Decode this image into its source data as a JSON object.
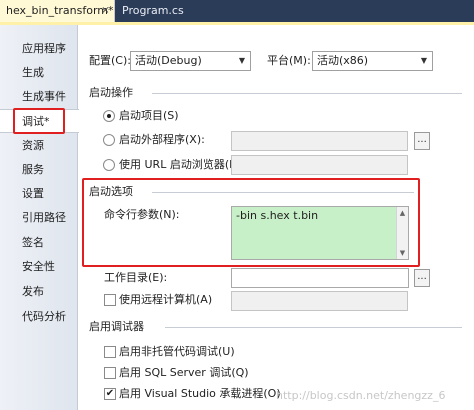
{
  "tabs": [
    {
      "label": "hex_bin_transform*",
      "close": "×"
    },
    {
      "label": "Program.cs"
    }
  ],
  "sidebar": {
    "items": [
      "应用程序",
      "生成",
      "生成事件",
      "调试*",
      "资源",
      "服务",
      "设置",
      "引用路径",
      "签名",
      "安全性",
      "发布",
      "代码分析"
    ]
  },
  "config": {
    "config_label": "配置(C):",
    "config_value": "活动(Debug)",
    "platform_label": "平台(M):",
    "platform_value": "活动(x86)"
  },
  "start_action": {
    "title": "启动操作",
    "opt1": "启动项目(S)",
    "opt2": "启动外部程序(X):",
    "opt3": "使用 URL 启动浏览器(R):",
    "browse": "..."
  },
  "start_options": {
    "title": "启动选项",
    "args_label": "命令行参数(N):",
    "args_value": "-bin s.hex t.bin",
    "workdir_label": "工作目录(E):",
    "remote_label": "使用远程计算机(A)",
    "browse": "..."
  },
  "debuggers": {
    "title": "启用调试器",
    "opt1": "启用非托管代码调试(U)",
    "opt2": "启用 SQL Server 调试(Q)",
    "opt3": "启用 Visual Studio 承载进程(O)",
    "check_mark": "✔"
  },
  "watermark": "http://blog.csdn.net/zhengzz_6"
}
